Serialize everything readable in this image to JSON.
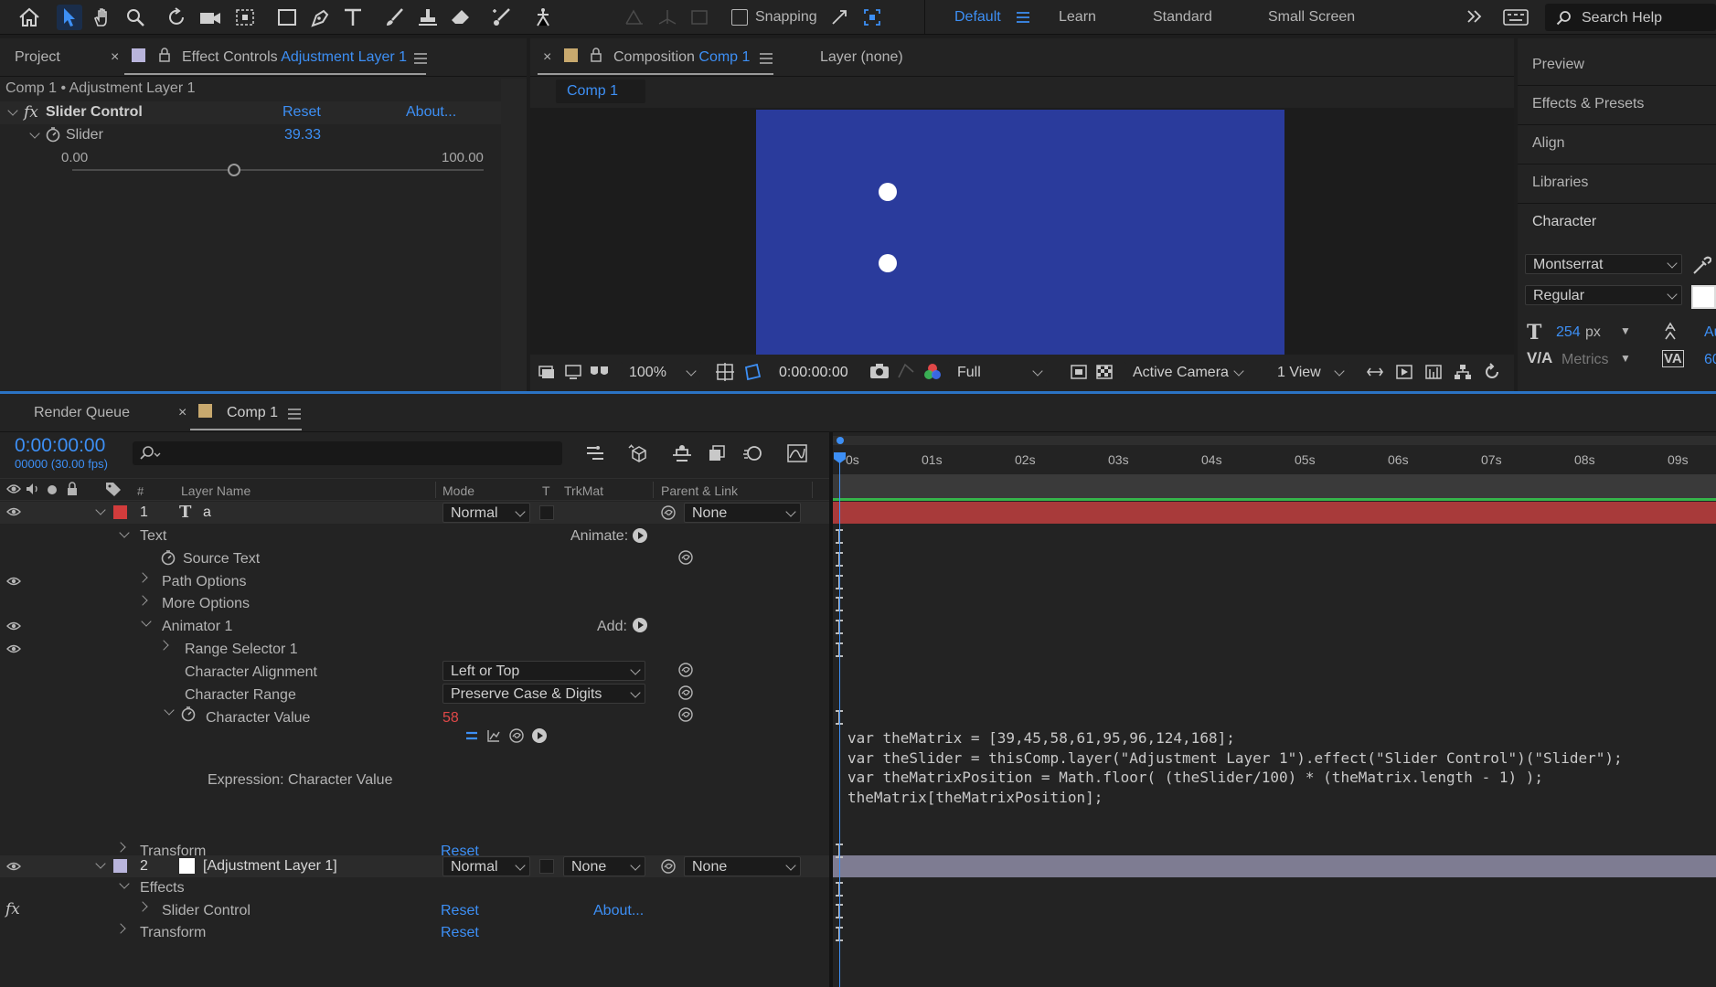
{
  "toolbar": {
    "snapping_label": "Snapping",
    "workspaces": [
      "Default",
      "Learn",
      "Standard",
      "Small Screen"
    ],
    "search_help": "Search Help"
  },
  "project_panel": {
    "tab_project": "Project",
    "tab_effect_controls": "Effect Controls",
    "tab_effect_controls_layer": "Adjustment Layer 1",
    "breadcrumb": "Comp 1 • Adjustment Layer 1",
    "effect_name": "Slider Control",
    "reset": "Reset",
    "about": "About...",
    "slider_label": "Slider",
    "slider_value": "39.33",
    "slider_min": "0.00",
    "slider_max": "100.00",
    "slider_fraction": 0.3933
  },
  "composition_panel": {
    "tab_label": "Composition",
    "tab_comp": "Comp 1",
    "layer_tab": "Layer (none)",
    "comp_subtab": "Comp 1",
    "canvas_color": "#2a3b9c",
    "zoom": "100%",
    "timecode": "0:00:00:00",
    "resolution": "Full",
    "camera": "Active Camera",
    "view": "1 View"
  },
  "right_panel": {
    "items": [
      "Preview",
      "Effects & Presets",
      "Align",
      "Libraries",
      "Character"
    ],
    "font_family": "Montserrat",
    "font_style": "Regular",
    "font_size": "254",
    "font_size_unit": "px",
    "kerning": "Metrics",
    "leading_partial": "Au",
    "tracking_partial": "60"
  },
  "timeline": {
    "tab_render_queue": "Render Queue",
    "tab_comp": "Comp 1",
    "timecode": "0:00:00:00",
    "fps": "00000 (30.00 fps)",
    "columns": {
      "hash": "#",
      "layer_name": "Layer Name",
      "mode": "Mode",
      "t": "T",
      "trkmat": "TrkMat",
      "parent": "Parent & Link"
    },
    "ruler": [
      "0s",
      "01s",
      "02s",
      "03s",
      "04s",
      "05s",
      "06s",
      "07s",
      "08s",
      "09s"
    ],
    "layer1": {
      "number": "1",
      "name": "a",
      "mode": "Normal",
      "parent": "None",
      "label_color": "#d23c3c"
    },
    "text_group": "Text",
    "animate_label": "Animate:",
    "source_text": "Source Text",
    "path_options": "Path Options",
    "more_options": "More Options",
    "animator": "Animator 1",
    "add_label": "Add:",
    "range_selector": "Range Selector 1",
    "char_alignment_label": "Character Alignment",
    "char_alignment_value": "Left or Top",
    "char_range_label": "Character Range",
    "char_range_value": "Preserve Case & Digits",
    "char_value_label": "Character Value",
    "char_value": "58",
    "expression_label": "Expression: Character Value",
    "expression_lines": [
      "var theMatrix = [39,45,58,61,95,96,124,168];",
      "var theSlider = thisComp.layer(\"Adjustment Layer 1\").effect(\"Slider Control\")(\"Slider\");",
      "var theMatrixPosition = Math.floor( (theSlider/100) * (theMatrix.length - 1) );",
      "theMatrix[theMatrixPosition];"
    ],
    "transform": "Transform",
    "reset": "Reset",
    "layer2": {
      "number": "2",
      "name": "[Adjustment Layer 1]",
      "mode": "Normal",
      "trkmat": "None",
      "parent": "None",
      "label_color": "#b9b5dc"
    },
    "effects_group": "Effects",
    "slider_control": "Slider Control",
    "about": "About..."
  }
}
